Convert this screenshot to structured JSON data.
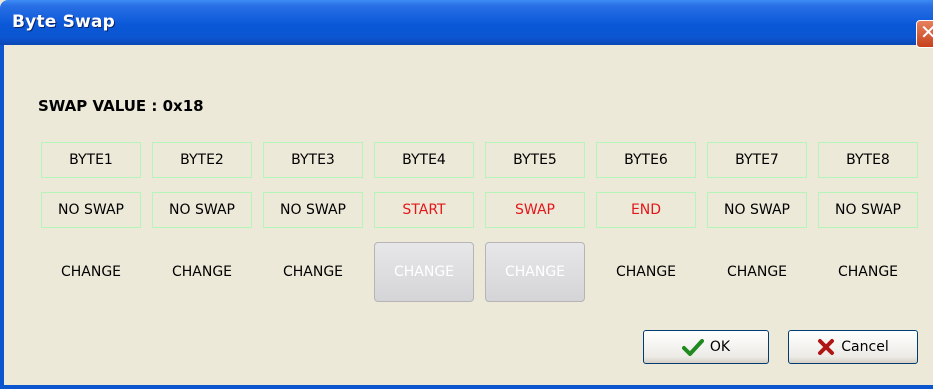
{
  "window": {
    "title": "Byte Swap",
    "close_glyph": "✕"
  },
  "swap_value": {
    "text": "SWAP VALUE :  0x18"
  },
  "bytes": [
    {
      "label": "BYTE1",
      "state": "NO SWAP",
      "state_color": "#000000",
      "change": "CHANGE",
      "change_enabled": true
    },
    {
      "label": "BYTE2",
      "state": "NO SWAP",
      "state_color": "#000000",
      "change": "CHANGE",
      "change_enabled": true
    },
    {
      "label": "BYTE3",
      "state": "NO SWAP",
      "state_color": "#000000",
      "change": "CHANGE",
      "change_enabled": true
    },
    {
      "label": "BYTE4",
      "state": "START",
      "state_color": "#e3171b",
      "change": "CHANGE",
      "change_enabled": false
    },
    {
      "label": "BYTE5",
      "state": "SWAP",
      "state_color": "#e3171b",
      "change": "CHANGE",
      "change_enabled": false
    },
    {
      "label": "BYTE6",
      "state": "END",
      "state_color": "#e3171b",
      "change": "CHANGE",
      "change_enabled": true
    },
    {
      "label": "BYTE7",
      "state": "NO SWAP",
      "state_color": "#000000",
      "change": "CHANGE",
      "change_enabled": true
    },
    {
      "label": "BYTE8",
      "state": "NO SWAP",
      "state_color": "#000000",
      "change": "CHANGE",
      "change_enabled": true
    }
  ],
  "buttons": {
    "ok": {
      "label": "OK",
      "icon": "checkmark-icon"
    },
    "cancel": {
      "label": "Cancel",
      "icon": "x-mark-icon"
    }
  },
  "colors": {
    "titlebar": "#0b55cf",
    "dialog_bg": "#ece9d8",
    "cell_border": "#b6f5ba",
    "active_state": "#e3171b"
  }
}
